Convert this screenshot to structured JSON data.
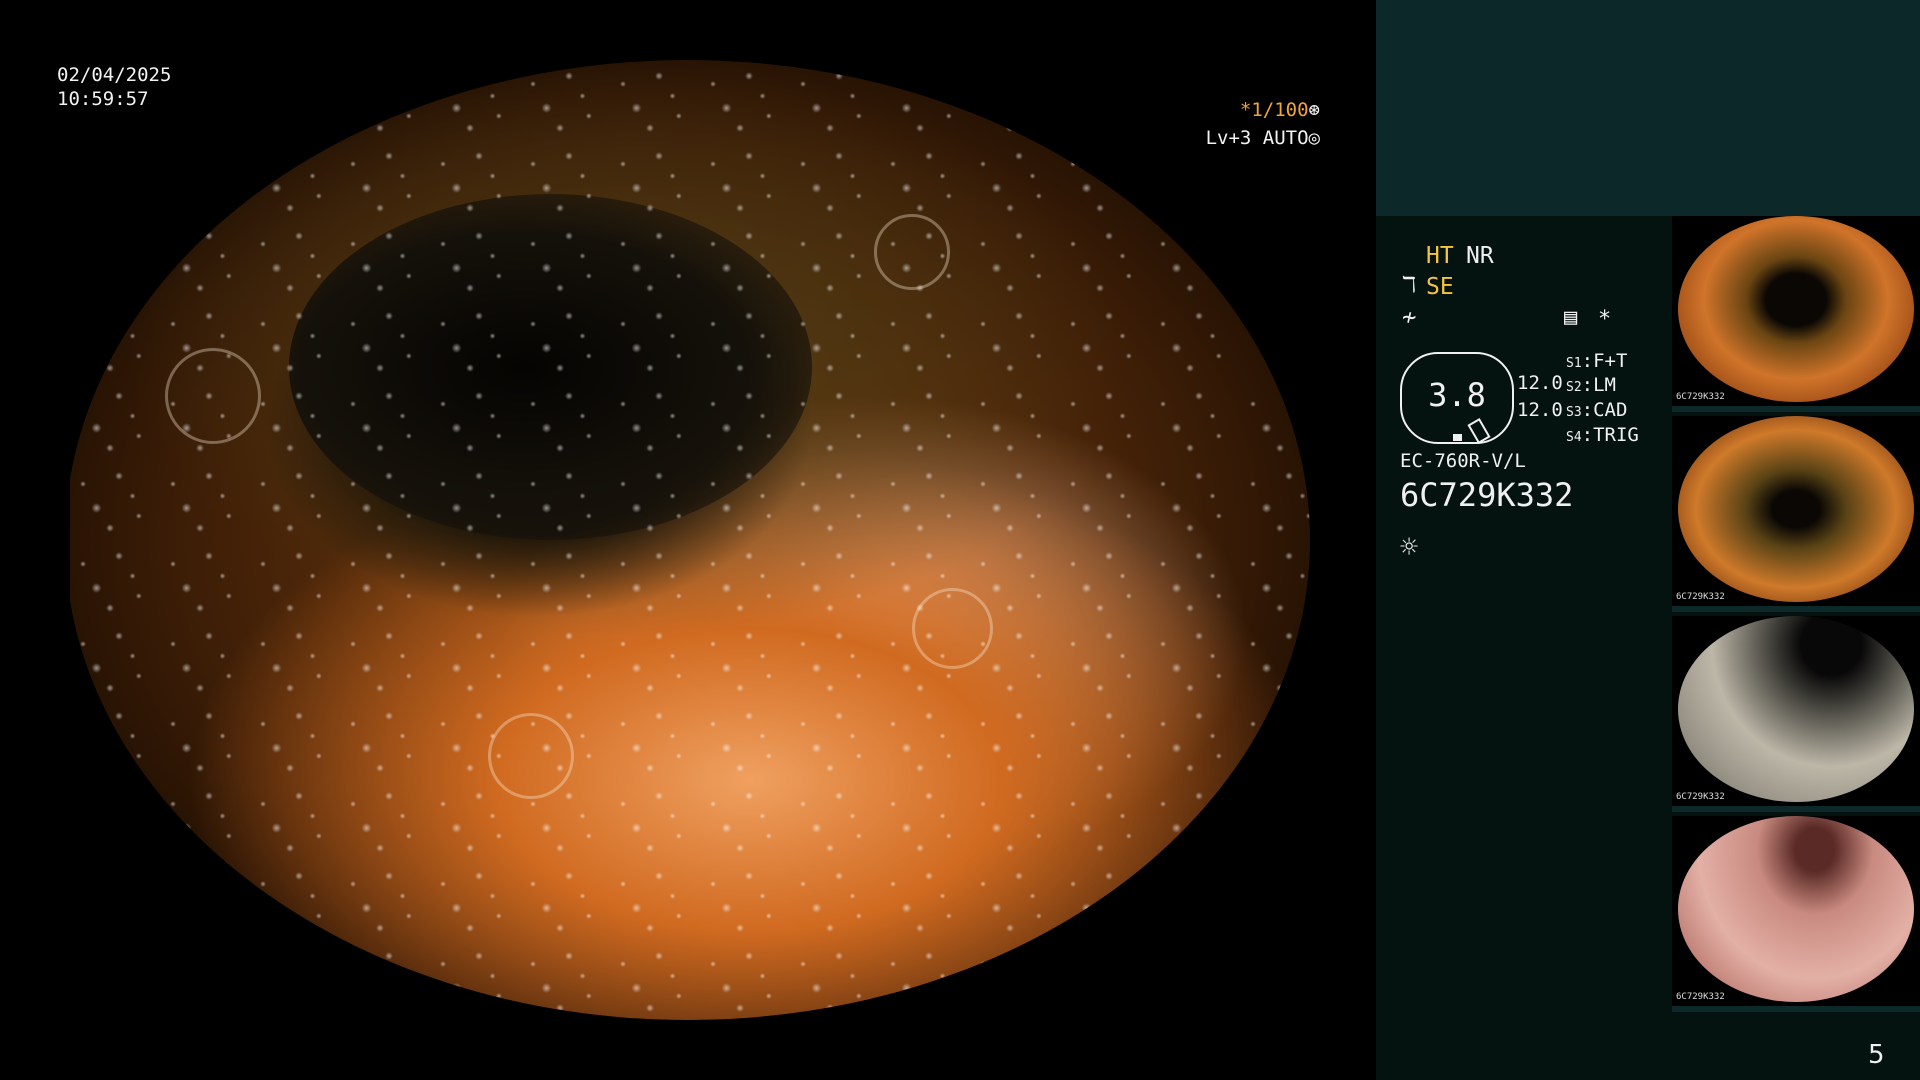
{
  "overlay": {
    "date": "02/04/2025",
    "time": "10:59:57",
    "shutter_prefix": "*1/100",
    "shutter_icon": "⊛",
    "level": "Lv+3 AUTO",
    "level_icon": "◎"
  },
  "panel": {
    "ht": "HT",
    "nr": "NR",
    "se": "SE",
    "enhance_icon": "enhancement-icon",
    "structure_icon": "structure-icon",
    "memo_icon": "memo-icon",
    "star": "*",
    "zoom_value": "3.8",
    "value_1": "12.0",
    "value_2": "12.0",
    "switches": [
      {
        "key": "S1",
        "value": "F+T"
      },
      {
        "key": "S2",
        "value": "LM"
      },
      {
        "key": "S3",
        "value": "CAD"
      },
      {
        "key": "S4",
        "value": "TRIG"
      }
    ],
    "scope_model": "EC-760R-V/L",
    "serial": "6C729K332",
    "light_icon": "sun-icon"
  },
  "thumbnails": [
    {
      "tag": "6C729K332"
    },
    {
      "tag": "6C729K332"
    },
    {
      "tag": "6C729K332"
    },
    {
      "tag": "6C729K332"
    }
  ],
  "page_number": "5"
}
